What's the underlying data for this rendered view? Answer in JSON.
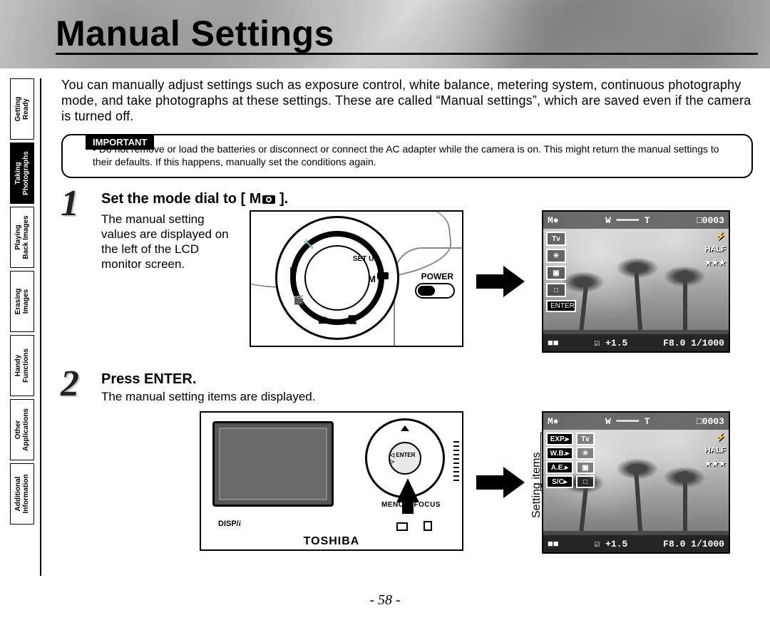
{
  "page": {
    "title": "Manual Settings",
    "intro": "You can manually adjust settings such as exposure control, white balance, metering system, continuous photography mode, and take photographs at these settings. These are called “Manual settings”, which are saved even if the camera is turned off.",
    "number": "- 58 -"
  },
  "sidebar": {
    "tabs": [
      {
        "label": "Getting\nReady",
        "active": false
      },
      {
        "label": "Taking\nPhotographs",
        "active": true
      },
      {
        "label": "Playing\nBack Images",
        "active": false
      },
      {
        "label": "Erasing\nImages",
        "active": false
      },
      {
        "label": "Handy\nFunctions",
        "active": false
      },
      {
        "label": "Other\nApplications",
        "active": false
      },
      {
        "label": "Additional\nInformation",
        "active": false
      }
    ]
  },
  "important": {
    "badge": "IMPORTANT",
    "bullet": "• Do not remove or load the batteries or disconnect or connect the AC adapter while the camera is on. This might return the manual settings to their defaults. If this happens, manually set the conditions again."
  },
  "steps": [
    {
      "num": "1",
      "heading_prefix": "Set the mode dial to [ M",
      "heading_suffix": " ].",
      "body": "The manual setting values are displayed on the left of the LCD monitor screen."
    },
    {
      "num": "2",
      "heading": "Press ENTER.",
      "body": "The manual setting items are displayed."
    }
  ],
  "dial": {
    "mode_letter": "M",
    "setup_label": "SET UP",
    "power_label": "POWER"
  },
  "camback": {
    "enter": "ENTER",
    "menu": "MENU",
    "focus": "FOCUS",
    "disp": "DISP/",
    "disp_i": "i",
    "brand": "TOSHIBA"
  },
  "lcd1": {
    "top_left": "M●",
    "zoom": "W ━━━━ T",
    "counter": "□0003",
    "icons": [
      "Tv",
      "☀",
      "▣",
      "□"
    ],
    "enter": "ENTER",
    "right": [
      "⚡",
      "HALF",
      "★★★"
    ],
    "bottom_left": "■■",
    "bottom_mid": "☑ +1.5",
    "bottom_right": "F8.0 1/1000"
  },
  "lcd2": {
    "top_left": "M●",
    "zoom": "W ━━━━ T",
    "counter": "□0003",
    "menu": [
      {
        "k": "EXP.▸",
        "v": "Tv"
      },
      {
        "k": "W.B.▸",
        "v": "☀"
      },
      {
        "k": "A.E.▸",
        "v": "▣"
      },
      {
        "k": "S/C▸",
        "v": "□"
      }
    ],
    "right": [
      "⚡",
      "HALF",
      "★★★"
    ],
    "bottom_left": "■■",
    "bottom_mid": "☑ +1.5",
    "bottom_right": "F8.0 1/1000",
    "side_label": "Setting items"
  }
}
